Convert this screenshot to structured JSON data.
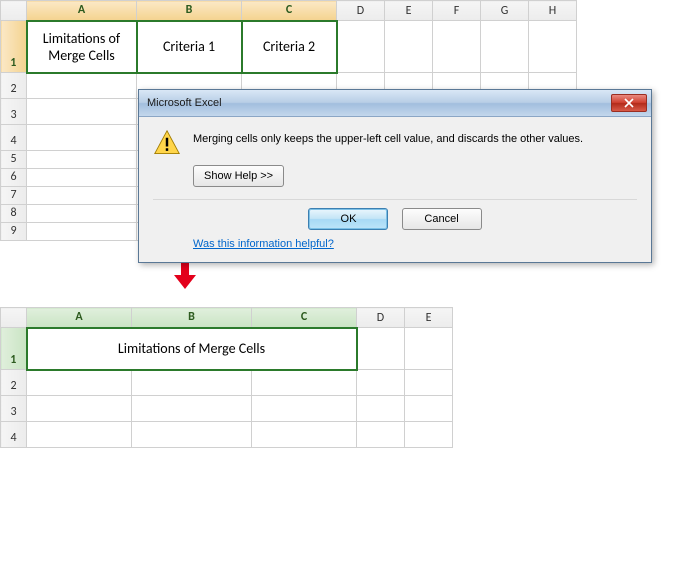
{
  "top_sheet": {
    "columns": [
      "A",
      "B",
      "C",
      "D",
      "E",
      "F",
      "G",
      "H"
    ],
    "rows": [
      "1",
      "2",
      "3",
      "4",
      "5",
      "6",
      "7",
      "8",
      "9"
    ],
    "selected_cols": [
      "A",
      "B",
      "C"
    ],
    "selected_row": "1",
    "cells": {
      "A1": "Limitations of Merge Cells",
      "B1": "Criteria 1",
      "C1": "Criteria 2"
    }
  },
  "dialog": {
    "title": "Microsoft Excel",
    "message": "Merging cells only keeps the upper-left cell value, and discards the other values.",
    "show_help_label": "Show Help >>",
    "ok_label": "OK",
    "cancel_label": "Cancel",
    "helpful_link": "Was this information helpful?"
  },
  "bottom_sheet": {
    "columns": [
      "A",
      "B",
      "C",
      "D",
      "E"
    ],
    "rows": [
      "1",
      "2",
      "3",
      "4"
    ],
    "merged_text": "Limitations of Merge Cells"
  }
}
